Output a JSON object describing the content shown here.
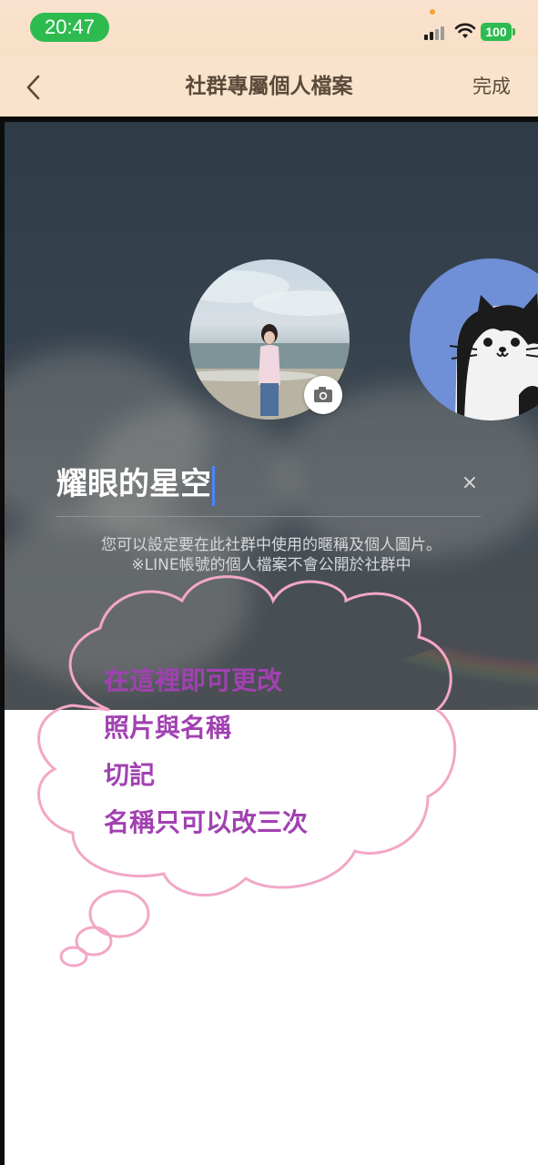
{
  "status_bar": {
    "time": "20:47",
    "battery": "100",
    "icons": [
      "signal-icon",
      "wifi-icon",
      "battery-icon"
    ]
  },
  "nav": {
    "back_icon": "chevron-left-icon",
    "title": "社群專屬個人檔案",
    "done": "完成"
  },
  "profile": {
    "name_value": "耀眼的星空",
    "clear_icon": "×",
    "camera_icon": "camera-icon",
    "hint_line1": "您可以設定要在此社群中使用的暱稱及個人圖片。",
    "hint_line2": "※LINE帳號的個人檔案不會公開於社群中"
  },
  "annotation": {
    "lines": [
      "在這裡即可更改",
      "照片與名稱",
      "切記",
      "名稱只可以改三次"
    ],
    "text_color": "#a141b1",
    "outline_color": "#f2a7c6"
  },
  "colors": {
    "header_bg": "#f9e3cc",
    "accent_green": "#2dbb4f",
    "caret_blue": "#4a86ff"
  }
}
